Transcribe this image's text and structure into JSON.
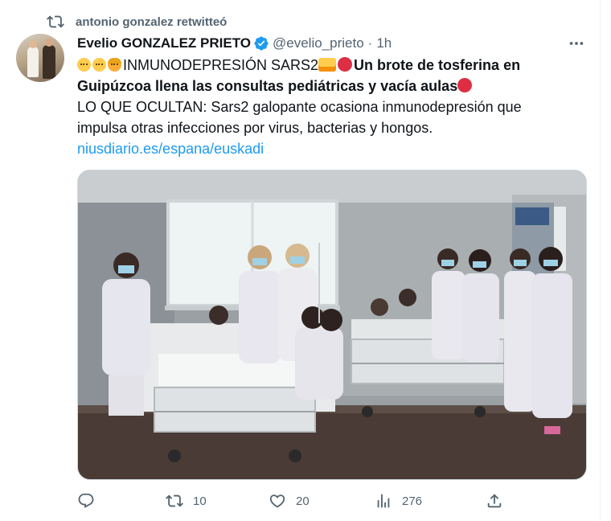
{
  "context": {
    "retweet_text": "antonio gonzalez retwitteó"
  },
  "tweet": {
    "author_name": "Evelio GONZALEZ PRIETO",
    "handle": "@evelio_prieto",
    "separator": "·",
    "time": "1h",
    "lines": {
      "l1_plain": "INMUNODEPRESIÓN SARS2",
      "l1_bold": "Un brote de tosferina en",
      "l2_bold": "Guipúzcoa llena las consultas pediátricas y vacía aulas",
      "l3": "LO QUE OCULTAN: Sars2 galopante ocasiona inmunodepresión que",
      "l4": "impulsa otras infecciones por virus, bacterias y hongos.",
      "link": "niusdiario.es/espana/euskadi"
    },
    "emoji_icons": [
      "baby-emoji",
      "child-emoji",
      "girl-emoji",
      "family-emoji",
      "red-circle-emoji",
      "red-circle-emoji"
    ]
  },
  "actions": {
    "reply_count": "",
    "retweet_count": "10",
    "like_count": "20",
    "views_count": "276"
  },
  "colors": {
    "accent": "#1d9bf0",
    "secondary_text": "#536471",
    "text": "#0f1419"
  }
}
